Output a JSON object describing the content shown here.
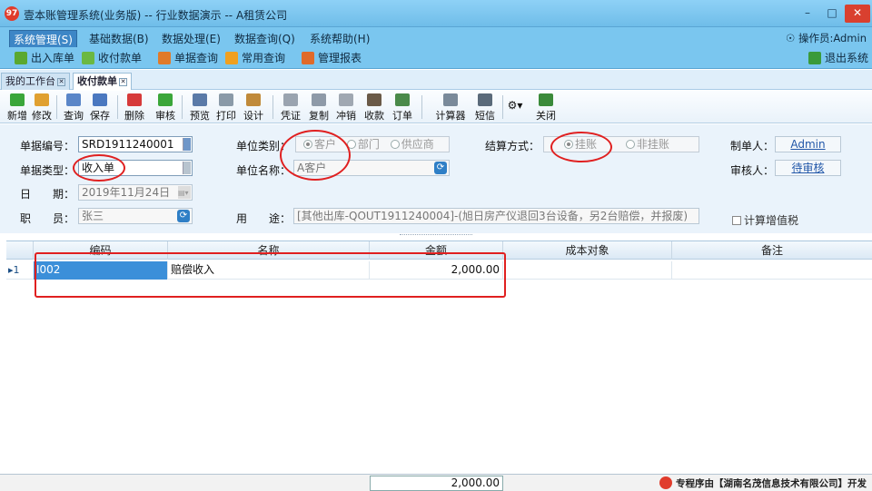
{
  "window": {
    "title": "壹本账管理系统(业务版) -- 行业数据演示 -- A租赁公司",
    "logo_text": "97",
    "minimize": "–",
    "maximize": "□",
    "close": "✕"
  },
  "menu": {
    "items": [
      "系统管理(S)",
      "基础数据(B)",
      "数据处理(E)",
      "数据查询(Q)",
      "系统帮助(H)"
    ],
    "operator": "操作员:Admin"
  },
  "quick": {
    "items": [
      "出入库单",
      "收付款单",
      "单据查询",
      "常用查询",
      "管理报表"
    ],
    "exit": "退出系统"
  },
  "tabs": {
    "items": [
      "我的工作台",
      "收付款单"
    ]
  },
  "toolbar": {
    "buttons": [
      "新增",
      "修改",
      "查询",
      "保存",
      "删除",
      "审核",
      "预览",
      "打印",
      "设计",
      "凭证",
      "复制",
      "冲销",
      "收款",
      "订单",
      "计算器",
      "短信",
      "",
      "关闭"
    ]
  },
  "form": {
    "doc_no_label": "单据编号：",
    "doc_no": "SRD1911240001",
    "doc_type_label": "单据类型：",
    "doc_type": "收入单",
    "date_label": "日　　期：",
    "date": "2019年11月24日",
    "staff_label": "职　　员：",
    "staff": "张三",
    "unit_type_label": "单位类别：",
    "unit_types": [
      "客户",
      "部门",
      "供应商"
    ],
    "unit_name_label": "单位名称：",
    "unit_name": "A客户",
    "purpose_label": "用　　途：",
    "purpose": "[其他出库-QOUT1911240004]-(旭日房产仪退回3台设备，另2台赔偿，并报废)",
    "settle_label": "结算方式：",
    "settle_options": [
      "挂账",
      "非挂账"
    ],
    "maker_label": "制单人：",
    "maker": "Admin",
    "auditor_label": "审核人：",
    "auditor": "待审核",
    "vat_label": "计算增值税"
  },
  "grid": {
    "columns": [
      "编码",
      "名称",
      "金额",
      "成本对象",
      "备注"
    ],
    "rows": [
      {
        "marker": "▸1",
        "code": "I002",
        "name": "赔偿收入",
        "amount": "2,000.00",
        "cost": "",
        "note": ""
      }
    ],
    "total": "2,000.00"
  },
  "footer": {
    "brand": "专程序由【湖南名茂信息技术有限公司】开发"
  },
  "colors": {
    "title_bar": "#7ac6ef",
    "selection": "#3b8fd9",
    "annotation": "#e02020"
  }
}
